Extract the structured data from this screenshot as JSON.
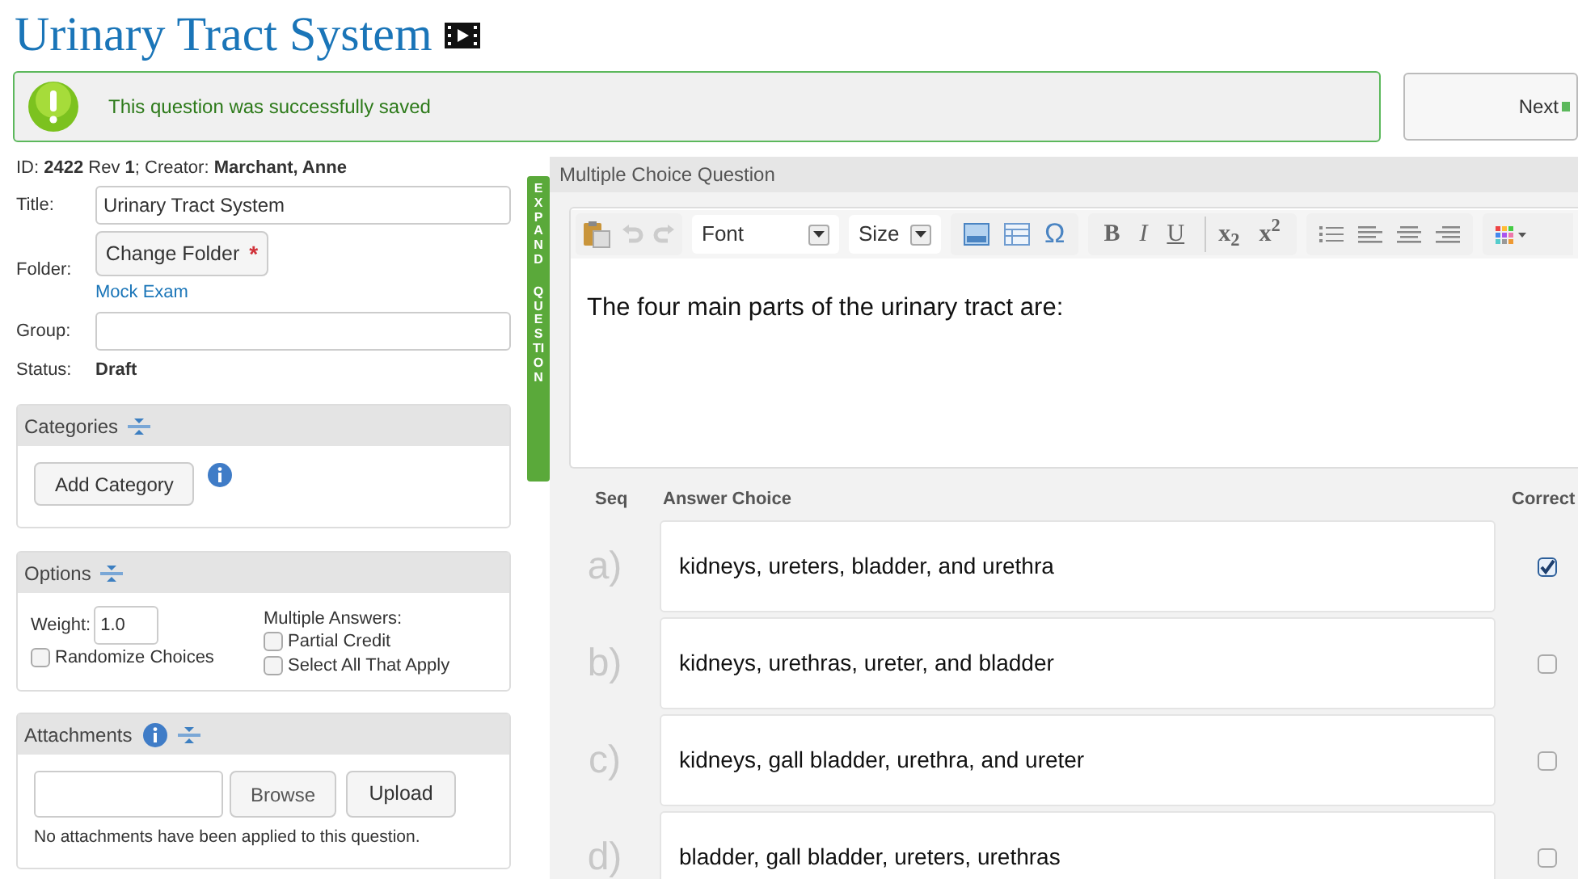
{
  "page_title": "Urinary Tract System",
  "banner": {
    "message": "This question was successfully saved"
  },
  "next_button": "Next",
  "meta": "ID: **2422** Rev **1**; Creator: **Marchant, Anne**",
  "form": {
    "title_label": "Title:",
    "title_value": "Urinary Tract System",
    "folder_label": "Folder:",
    "folder_button": "Change Folder",
    "required_mark": "*",
    "folder_name": "Mock Exam",
    "group_label": "Group:",
    "status_label": "Status:",
    "status_value": "Draft"
  },
  "categories": {
    "heading": "Categories",
    "button": "Add Category"
  },
  "options": {
    "heading": "Options",
    "weight_label": "Weight:",
    "weight_value": "1.0",
    "multiple_label": "Multiple Answers:",
    "checkboxes": [
      {
        "label": "Randomize Choices",
        "checked": false
      },
      {
        "label": "Partial Credit",
        "checked": false
      },
      {
        "label": "Select All That Apply",
        "checked": false
      }
    ]
  },
  "attachments": {
    "heading": "Attachments",
    "browse": "Browse",
    "upload": "Upload",
    "note": "No attachments have been applied to this question."
  },
  "expand_tab": [
    "EXPAND",
    "QUESTION"
  ],
  "question": {
    "heading": "Multiple Choice Question",
    "font": "Font",
    "size": "Size",
    "symbol": "Ω",
    "bold": "B",
    "italic": "I",
    "underline": "U",
    "subscript": "x$_{2}$",
    "superscript": "x$^{2}$",
    "text": "The four main parts of the urinary tract are:"
  },
  "answers": {
    "columns": [
      "Seq",
      "Answer Choice",
      "Correct"
    ],
    "rows": [
      {
        "seq": "a)",
        "text": "kidneys, ureters, bladder, and urethra",
        "correct": true
      },
      {
        "seq": "b)",
        "text": "kidneys, urethras, ureter, and bladder",
        "correct": false
      },
      {
        "seq": "c)",
        "text": "kidneys, gall bladder, urethra, and ureter",
        "correct": false
      },
      {
        "seq": "d)",
        "text": "bladder, gall bladder, ureters, urethras",
        "correct": false
      }
    ]
  }
}
